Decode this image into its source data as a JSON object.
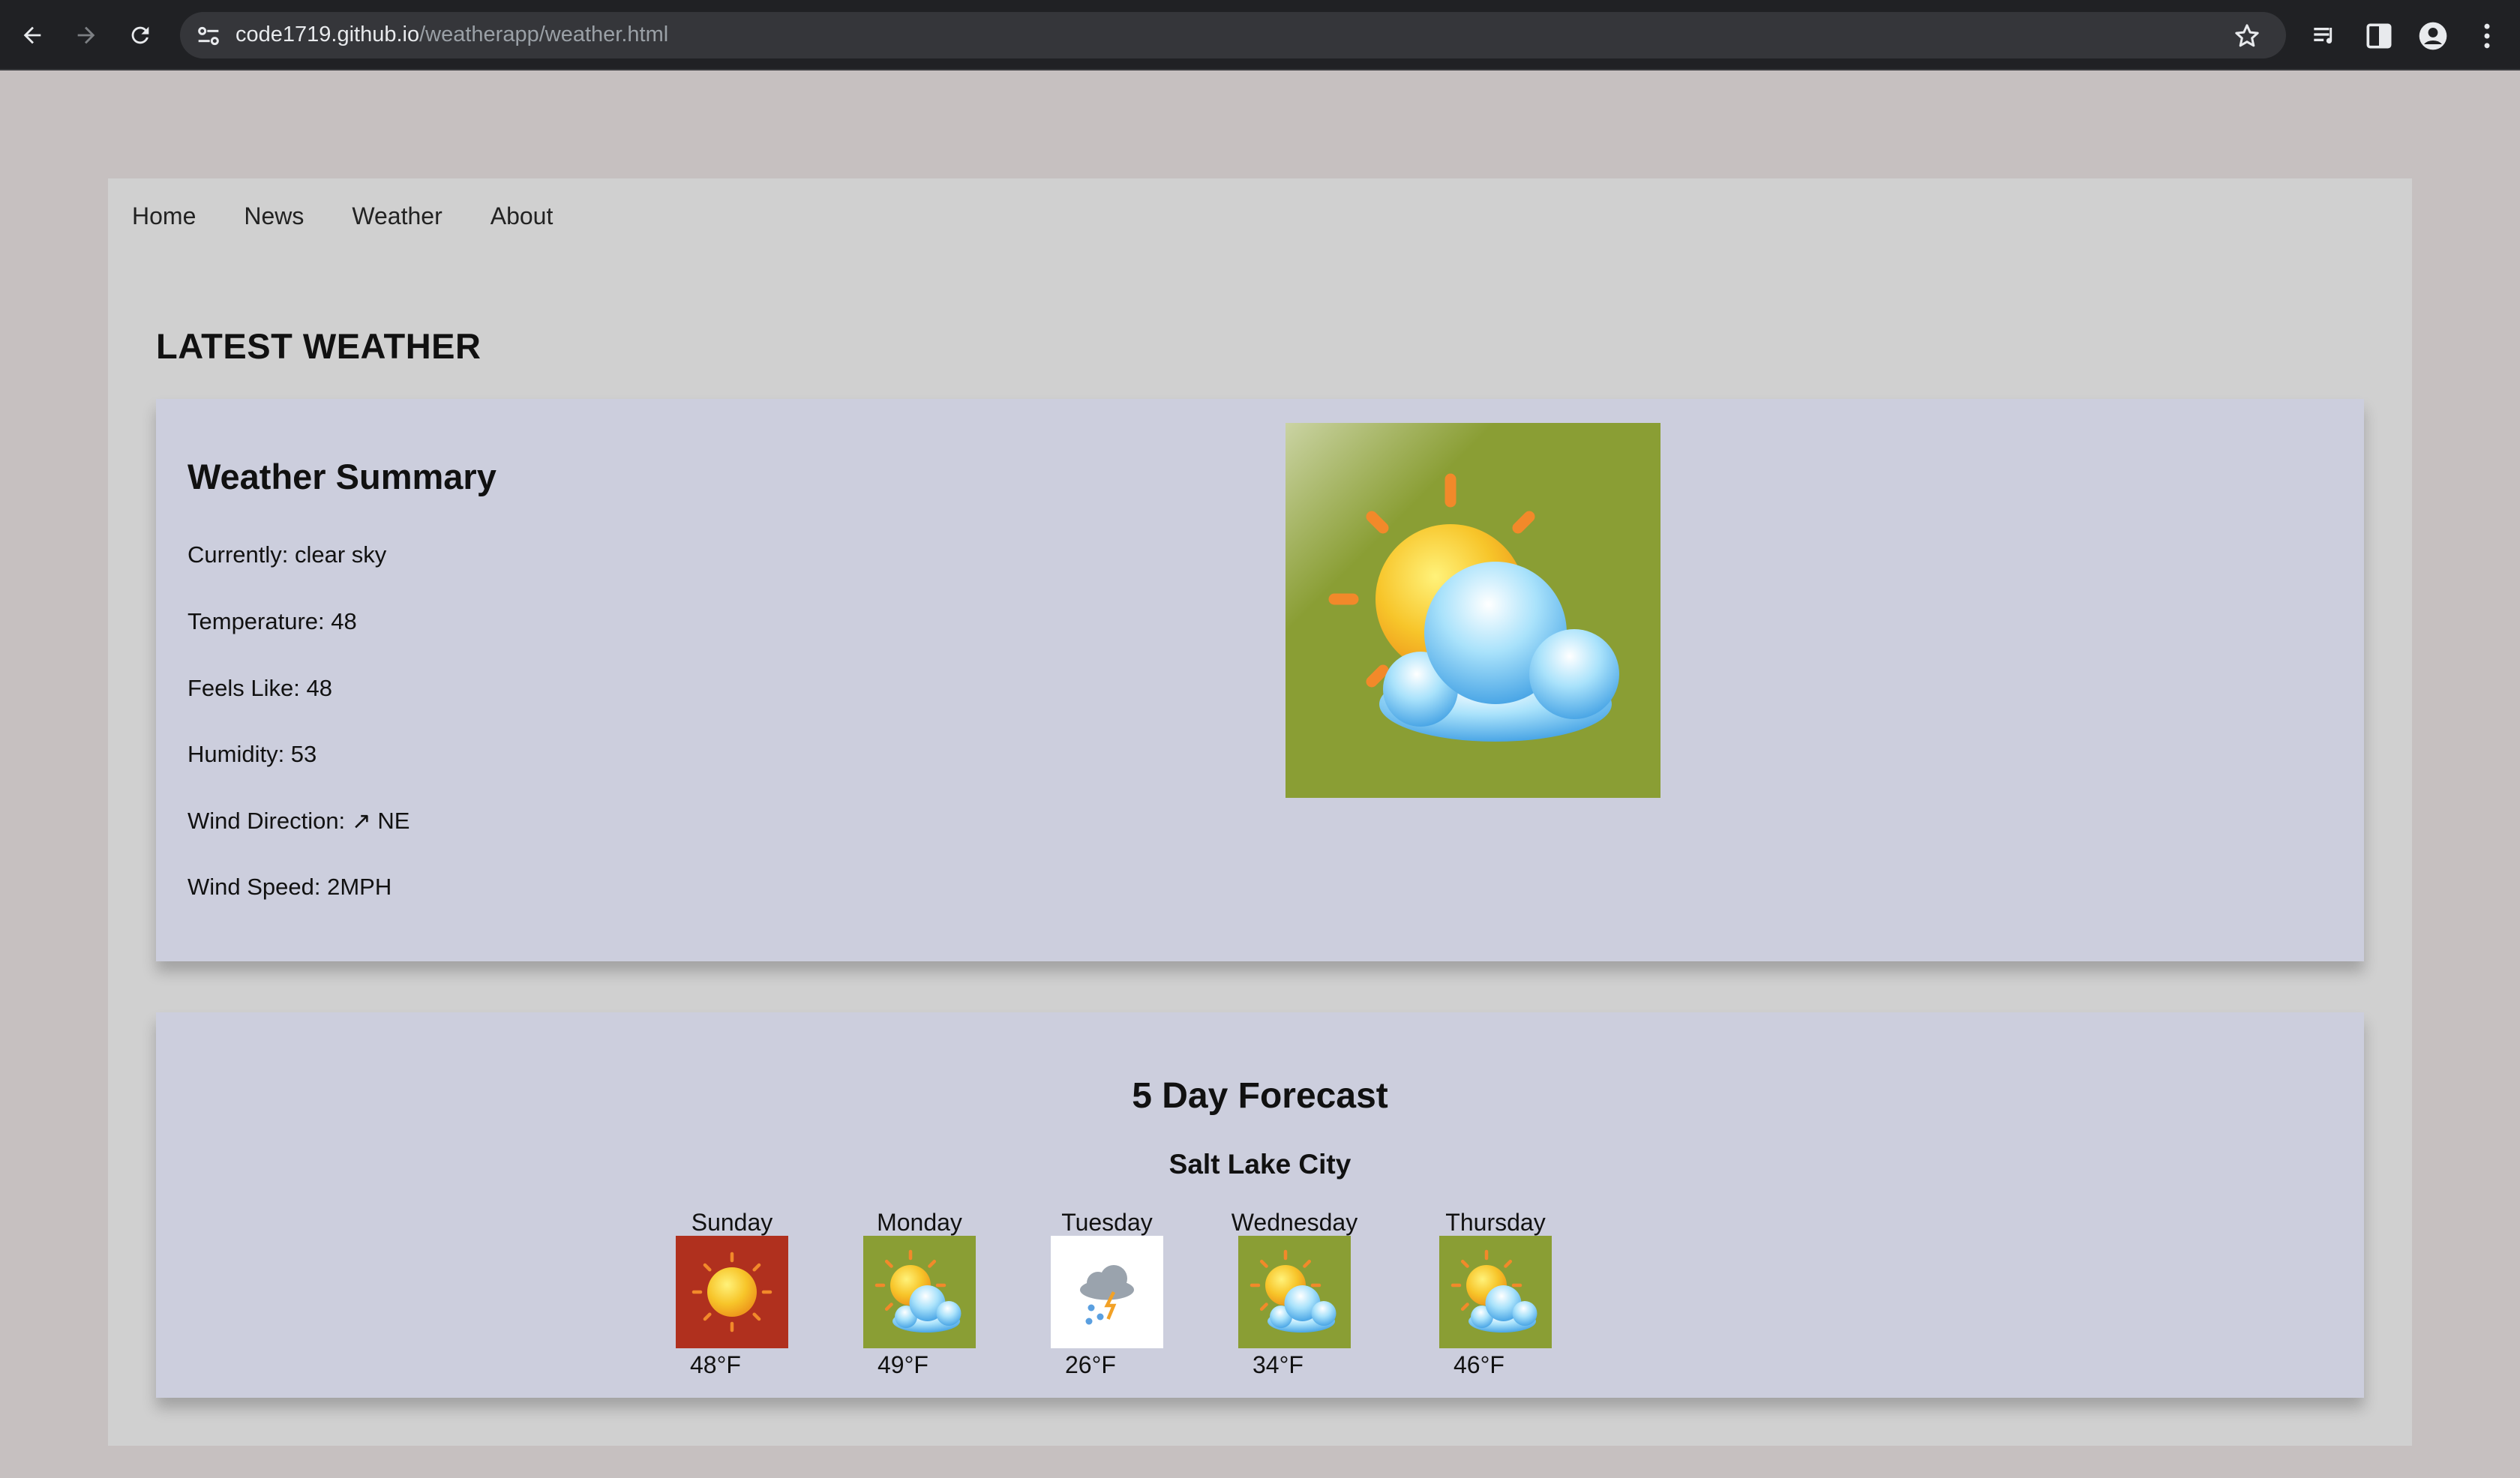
{
  "browser": {
    "url_host": "code1719.github.io",
    "url_path": "/weatherapp/weather.html"
  },
  "nav": {
    "items": [
      "Home",
      "News",
      "Weather",
      "About"
    ]
  },
  "page": {
    "heading": "LATEST WEATHER"
  },
  "summary": {
    "title": "Weather Summary",
    "currently": "Currently: clear sky",
    "temperature": "Temperature: 48",
    "feels_like": "Feels Like: 48",
    "humidity": "Humidity: 53",
    "wind_direction": "Wind Direction: ↗ NE",
    "wind_speed": "Wind Speed: 2MPH",
    "icon": "partly-cloudy-icon",
    "icon_bg": "#8a9e34"
  },
  "forecast": {
    "title": "5 Day Forecast",
    "city": "Salt Lake City",
    "days": [
      {
        "name": "Sunday",
        "temp": "48°F",
        "icon": "sunny-icon",
        "bg": "#b0301e"
      },
      {
        "name": "Monday",
        "temp": "49°F",
        "icon": "partly-cloudy-icon",
        "bg": "#8a9e34"
      },
      {
        "name": "Tuesday",
        "temp": "26°F",
        "icon": "snow-thunder-icon",
        "bg": "#ffffff"
      },
      {
        "name": "Wednesday",
        "temp": "34°F",
        "icon": "partly-cloudy-icon",
        "bg": "#8a9e34"
      },
      {
        "name": "Thursday",
        "temp": "46°F",
        "icon": "partly-cloudy-icon",
        "bg": "#8a9e34"
      }
    ]
  },
  "colors": {
    "page_bg": "#c6c0c0",
    "card_bg": "#d0d0d0",
    "panel_bg": "#cccedd",
    "chrome_bg": "#202124"
  }
}
